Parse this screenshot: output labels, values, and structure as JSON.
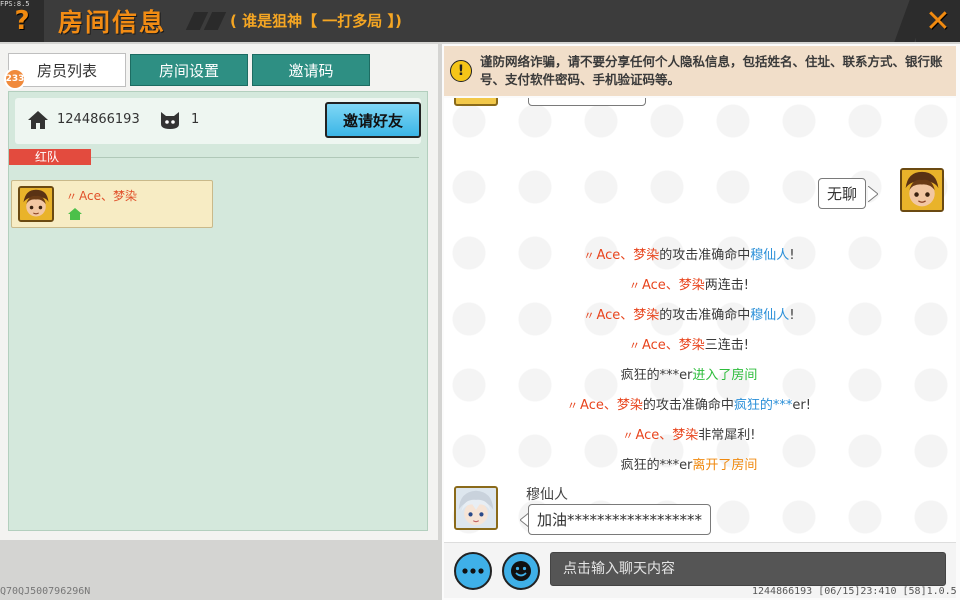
{
  "header": {
    "fps": "FPS:8.5",
    "help_icon": "?",
    "title": "房间信息",
    "subtitle": "( 谁是狙神【 一打多局 】)",
    "close_icon": "✕"
  },
  "tabs": [
    {
      "label": "房员列表",
      "active": true
    },
    {
      "label": "房间设置",
      "active": false
    },
    {
      "label": "邀请码",
      "active": false
    }
  ],
  "badge": "233",
  "room": {
    "id": "1244866193",
    "member_count": "1",
    "invite_label": "邀请好友",
    "home_icon": "home-icon",
    "member_icon": "cat-icon"
  },
  "team": {
    "name": "红队",
    "members": [
      {
        "name": "Ace、梦染",
        "is_host": true
      }
    ]
  },
  "warning": {
    "icon": "!",
    "text": "谨防网络诈骗，请不要分享任何个人隐私信息，包括姓名、住址、联系方式、银行账号、支付软件密码、手机验证码等。"
  },
  "chat": {
    "self_message": "无聊",
    "system_lines": [
      {
        "parts": [
          {
            "t": "Ace、梦染",
            "c": "red"
          },
          {
            "t": "的攻击准确命中",
            "c": "dark"
          },
          {
            "t": "穆仙人",
            "c": "blue"
          },
          {
            "t": "!",
            "c": "dark"
          }
        ],
        "quote": true
      },
      {
        "parts": [
          {
            "t": "Ace、梦染",
            "c": "red"
          },
          {
            "t": "两连击!",
            "c": "dark"
          }
        ],
        "quote": true
      },
      {
        "parts": [
          {
            "t": "Ace、梦染",
            "c": "red"
          },
          {
            "t": "的攻击准确命中",
            "c": "dark"
          },
          {
            "t": "穆仙人",
            "c": "blue"
          },
          {
            "t": "!",
            "c": "dark"
          }
        ],
        "quote": true
      },
      {
        "parts": [
          {
            "t": "Ace、梦染",
            "c": "red"
          },
          {
            "t": "三连击!",
            "c": "dark"
          }
        ],
        "quote": true
      },
      {
        "parts": [
          {
            "t": "疯狂的***er",
            "c": "dark"
          },
          {
            "t": "进入了房间",
            "c": "green"
          }
        ],
        "quote": false
      },
      {
        "parts": [
          {
            "t": "Ace、梦染",
            "c": "red"
          },
          {
            "t": "的攻击准确命中",
            "c": "dark"
          },
          {
            "t": "疯狂的***",
            "c": "blue"
          },
          {
            "t": "er!",
            "c": "dark"
          }
        ],
        "quote": true
      },
      {
        "parts": [
          {
            "t": "Ace、梦染",
            "c": "red"
          },
          {
            "t": "非常犀利!",
            "c": "dark"
          }
        ],
        "quote": true
      },
      {
        "parts": [
          {
            "t": "疯狂的***er",
            "c": "dark"
          },
          {
            "t": "离开了房间",
            "c": "orange"
          }
        ],
        "quote": false
      }
    ],
    "other_sender": "穆仙人",
    "other_message": "加油******************"
  },
  "input": {
    "placeholder": "点击输入聊天内容",
    "more_icon": "ellipsis-icon",
    "emoji_icon": "smile-icon"
  },
  "footer": {
    "left": "Q70QJ500796296N",
    "right": "1244866193 [06/15]23:410 [58]1.0.5"
  },
  "colors": {
    "accent": "#f08a10",
    "team_red": "#e34b3e",
    "tab_teal": "#2e8f83",
    "name_red": "#e8451e",
    "name_blue": "#2a8fd8",
    "join_green": "#2ebd3c",
    "leave_orange": "#f08a10"
  }
}
